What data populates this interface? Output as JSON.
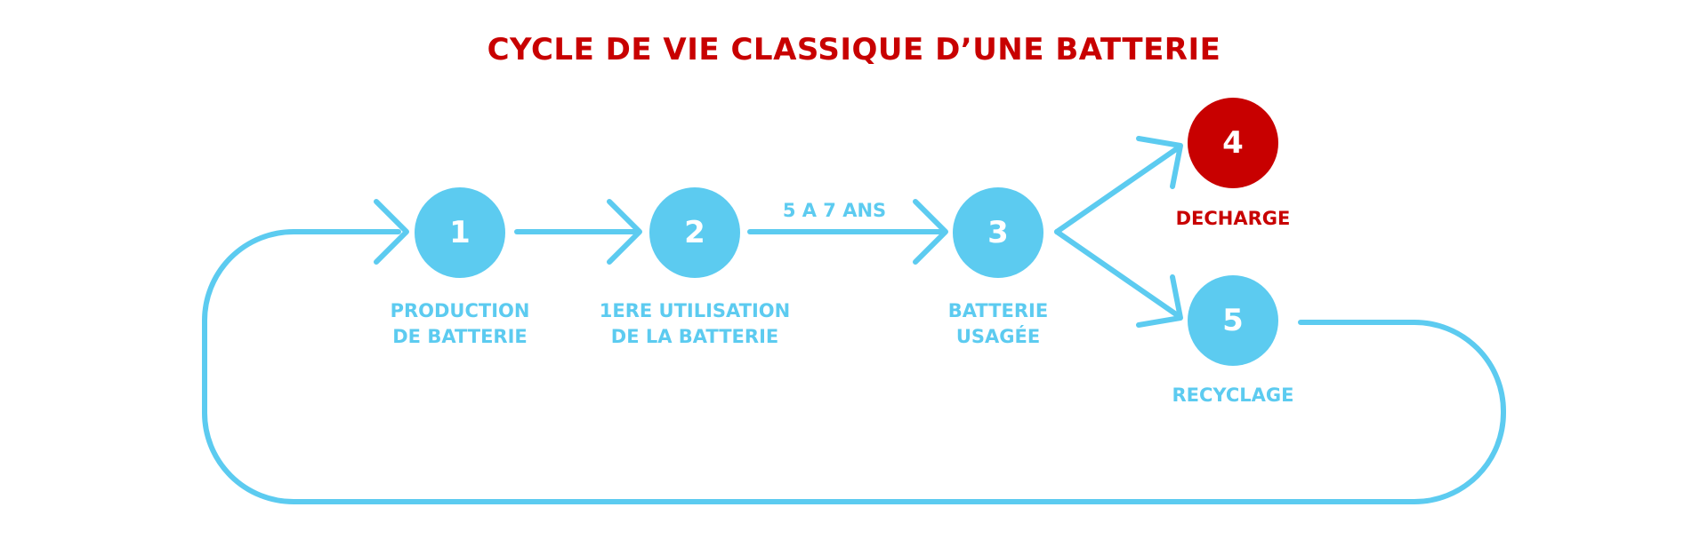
{
  "title": "CYCLE DE VIE CLASSIQUE D’UNE BATTERIE",
  "colors": {
    "primary": "#5ccbf0",
    "accent": "#c80000",
    "background": "#ffffff"
  },
  "edge_label": "5 A 7 ANS",
  "nodes": [
    {
      "number": "1",
      "label_line1": "PRODUCTION",
      "label_line2": "DE BATTERIE"
    },
    {
      "number": "2",
      "label_line1": "1ERE UTILISATION",
      "label_line2": "DE LA BATTERIE"
    },
    {
      "number": "3",
      "label_line1": "BATTERIE",
      "label_line2": "USAGÉE"
    },
    {
      "number": "4",
      "label_line1": "DECHARGE",
      "label_line2": ""
    },
    {
      "number": "5",
      "label_line1": "RECYCLAGE",
      "label_line2": ""
    }
  ]
}
